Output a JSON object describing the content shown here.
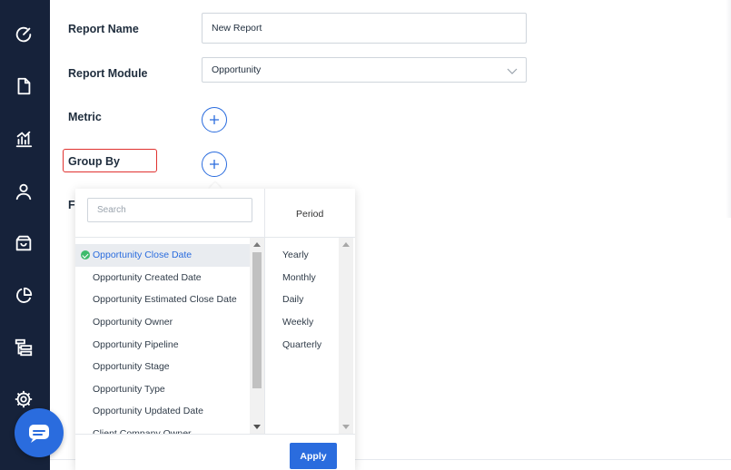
{
  "sidebar": {
    "items": [
      {
        "icon": "speedometer-icon"
      },
      {
        "icon": "document-icon"
      },
      {
        "icon": "bar-chart-icon"
      },
      {
        "icon": "user-icon"
      },
      {
        "icon": "inbox-icon"
      },
      {
        "icon": "pie-chart-icon"
      },
      {
        "icon": "hierarchy-icon"
      },
      {
        "icon": "gear-icon"
      }
    ]
  },
  "form": {
    "report_name_label": "Report Name",
    "report_name_value": "New Report",
    "report_module_label": "Report Module",
    "report_module_value": "Opportunity",
    "metric_label": "Metric",
    "group_by_label": "Group By",
    "cutoff_label": "Fi"
  },
  "dropdown": {
    "search_placeholder": "Search",
    "period_header": "Period",
    "fields": [
      {
        "label": "Opportunity Close Date",
        "selected": true
      },
      {
        "label": "Opportunity Created Date"
      },
      {
        "label": "Opportunity Estimated Close Date"
      },
      {
        "label": "Opportunity Owner"
      },
      {
        "label": "Opportunity Pipeline"
      },
      {
        "label": "Opportunity Stage"
      },
      {
        "label": "Opportunity Type"
      },
      {
        "label": "Opportunity Updated Date"
      },
      {
        "label": "Client Company Owner"
      }
    ],
    "periods": [
      "Yearly",
      "Monthly",
      "Daily",
      "Weekly",
      "Quarterly"
    ],
    "apply_label": "Apply"
  },
  "colors": {
    "sidebar": "#16223a",
    "accent": "#2a6cde",
    "highlight": "#e0322f",
    "selected_check": "#3dbb6c"
  },
  "chat": {
    "icon": "chat-icon"
  }
}
